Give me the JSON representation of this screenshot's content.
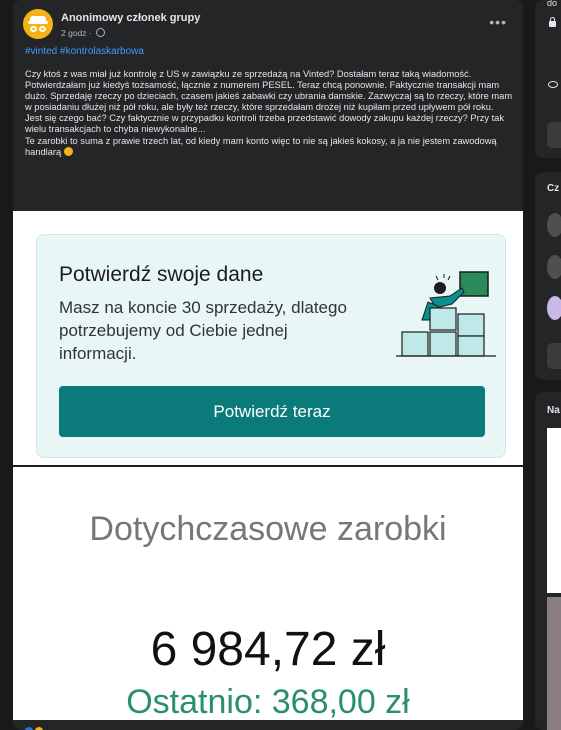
{
  "post": {
    "author": "Anonimowy członek grupy",
    "time": "2 godz",
    "hashtags": [
      "#vinted",
      "#kontrolaskarbowa"
    ],
    "paragraphs": [
      "Czy ktoś z was miał już kontrolę z US w zawiązku ze sprzedażą na Vinted? Dostałam teraz taką wiadomość. Potwierdzałam już kiedyś tożsamość, łącznie z numerem PESEL. Teraz chcą ponownie. Faktycznie transakcji mam dużo. Sprzedaję rzeczy po dzieciach, czasem jakieś zabawki czy ubrania damskie. Zazwyczaj są to rzeczy, które mam w posiadaniu dłużej niż pół roku, ale były też rzeczy, które sprzedałam drożej niż kupiłam przed upływem pół roku.",
      "Jest się czego bać? Czy faktycznie w przypadku kontroli trzeba przedstawić dowody zakupu każdej rzeczy? Przy tak wielu transakcjach to chyba niewykonalne...",
      "Te zarobki to suma z prawie trzech lat, od kiedy mam konto więc to nie są jakieś kokosy, a ja nie jestem zawodową handlarą"
    ]
  },
  "image1": {
    "title": "Potwierdź swoje dane",
    "description": "Masz na koncie 30 sprzedaży, dlatego potrzebujemy od Ciebie jednej informacji.",
    "button": "Potwierdź teraz"
  },
  "image2": {
    "label": "Dotychczasowe zarobki",
    "value": "6 984,72 zł",
    "recent": "Ostatnio: 368,00 zł"
  },
  "sidebar": {
    "top_text": "do",
    "heading1": "Cz",
    "heading2": "Na"
  },
  "colors": {
    "accent": "#0a7a7a",
    "link": "#4599ff",
    "recent": "#2a8f6e"
  },
  "icons": [
    "globe-icon",
    "more-icon",
    "lock-icon",
    "eye-icon",
    "emoji-icon"
  ]
}
